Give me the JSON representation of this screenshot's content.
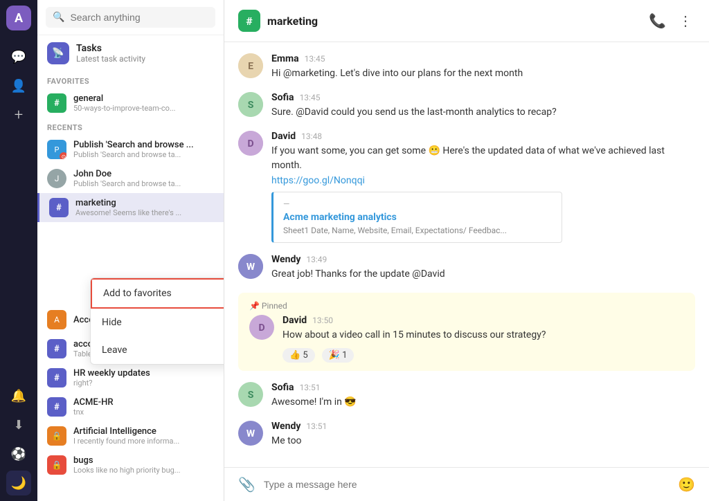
{
  "iconBar": {
    "avatar": "A",
    "navItems": [
      {
        "name": "chat-icon",
        "icon": "💬",
        "active": false
      },
      {
        "name": "contacts-icon",
        "icon": "👤",
        "active": false
      },
      {
        "name": "add-icon",
        "icon": "+",
        "active": false
      }
    ],
    "bottomItems": [
      {
        "name": "bell-icon",
        "icon": "🔔"
      },
      {
        "name": "download-icon",
        "icon": "⬇"
      },
      {
        "name": "soccer-icon",
        "icon": "⚽"
      },
      {
        "name": "moon-icon",
        "icon": "🌙",
        "active": true
      }
    ]
  },
  "sidebar": {
    "search": {
      "placeholder": "Search anything"
    },
    "tasks": {
      "title": "Tasks",
      "subtitle": "Latest task activity"
    },
    "favoritesLabel": "FAVORITES",
    "favorites": [
      {
        "name": "general",
        "sub": "50-ways-to-improve-team-co...",
        "iconType": "green",
        "iconChar": "#"
      }
    ],
    "recentsLabel": "RECENTS",
    "recents": [
      {
        "name": "Publish 'Search and browse ...",
        "sub": "Publish 'Search and browse ta...",
        "iconType": "avatar-blue",
        "isAvatar": true,
        "avatarChar": "P"
      },
      {
        "name": "John Doe",
        "sub": "Publish 'Search and browse ta...",
        "iconType": "avatar-gray",
        "isAvatar": true,
        "avatarChar": "J"
      },
      {
        "name": "marketing",
        "sub": "Awesome! Seems like there's ...",
        "iconType": "purple",
        "iconChar": "#",
        "active": true
      }
    ],
    "contextMenu": {
      "items": [
        {
          "label": "Add to favorites",
          "highlighted": true
        },
        {
          "label": "Hide",
          "highlighted": false
        },
        {
          "label": "Leave",
          "highlighted": false
        }
      ]
    },
    "moreChannels": [
      {
        "name": "Accelerated cache works wor...",
        "iconType": "avatar-orange",
        "isAvatar": true,
        "avatarChar": "A"
      },
      {
        "name": "accounts",
        "sub": "Tableau_NS_Whitepaper_The_...",
        "iconType": "purple",
        "iconChar": "#"
      },
      {
        "name": "HR weekly updates",
        "sub": "right?",
        "iconType": "purple",
        "iconChar": "#"
      },
      {
        "name": "ACME-HR",
        "sub": "tnx",
        "iconType": "purple",
        "iconChar": "#"
      },
      {
        "name": "Artificial Intelligence",
        "sub": "I recently found more informa...",
        "iconType": "orange",
        "iconChar": "🔒"
      },
      {
        "name": "bugs",
        "sub": "Looks like no high priority bug...",
        "iconType": "red",
        "iconChar": "🔒"
      }
    ]
  },
  "chat": {
    "channelName": "marketing",
    "messages": [
      {
        "id": 1,
        "sender": "Emma",
        "time": "13:45",
        "text": "Hi @marketing. Let's dive into our plans for the next month",
        "avatarClass": "emma"
      },
      {
        "id": 2,
        "sender": "Sofia",
        "time": "13:45",
        "text": "Sure. @David could you send us the last-month analytics to recap?",
        "avatarClass": "sofia"
      },
      {
        "id": 3,
        "sender": "David",
        "time": "13:48",
        "text": "If you want some, you can get some 😬 Here's the updated data of what we've achieved last month.",
        "hasLink": true,
        "linkUrl": "https://goo.gl/Nonqqi",
        "previewTitle": "Acme marketing analytics",
        "previewSub": "Sheet1 Date, Name, Website, Email, Expectations/ Feedbac...",
        "avatarClass": "david"
      },
      {
        "id": 4,
        "sender": "Wendy",
        "time": "13:49",
        "text": "Great job! Thanks for the update @David",
        "avatarClass": "wendy"
      },
      {
        "id": 5,
        "sender": "David",
        "time": "13:50",
        "text": "How about a video call in 15 minutes to discuss our strategy?",
        "isPinned": true,
        "pinLabel": "📌 Pinned",
        "avatarClass": "david",
        "reactions": [
          {
            "emoji": "👍",
            "count": 5
          },
          {
            "emoji": "🎉",
            "count": 1
          }
        ]
      },
      {
        "id": 6,
        "sender": "Sofia",
        "time": "13:51",
        "text": "Awesome! I'm in 😎",
        "avatarClass": "sofia2"
      },
      {
        "id": 7,
        "sender": "Wendy",
        "time": "13:51",
        "text": "Me too",
        "avatarClass": "wendy2"
      }
    ],
    "inputPlaceholder": "Type a message here"
  }
}
